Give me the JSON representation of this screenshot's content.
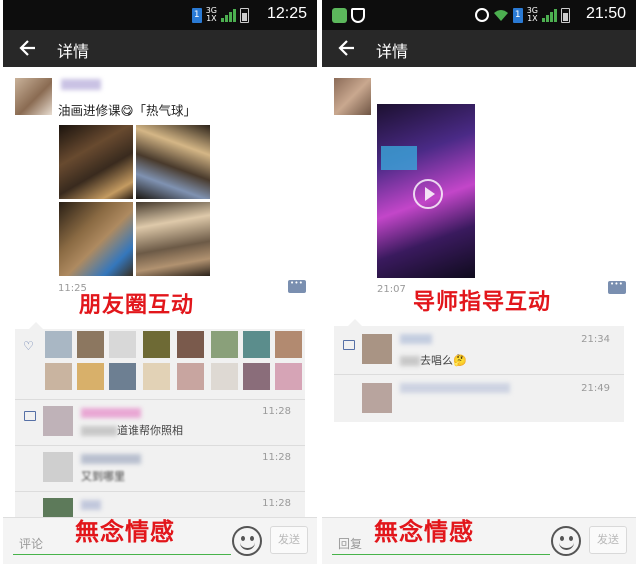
{
  "left": {
    "status_time": "12:25",
    "network": "3G",
    "network2": "1X",
    "title": "详情",
    "post_text": "油画进修课😋「热气球」",
    "post_time": "11:25",
    "caption": "朋友圈互动",
    "comments": [
      {
        "text": "道谁帮你照相",
        "time": "11:28"
      },
      {
        "text": "又到哪里",
        "time": "11:28"
      },
      {
        "text": "",
        "time": "11:28"
      }
    ],
    "input_placeholder": "评论",
    "send_label": "发送",
    "watermark": "無念情感"
  },
  "right": {
    "status_time": "21:50",
    "network": "3G",
    "network2": "1X",
    "title": "详情",
    "post_time": "21:07",
    "caption": "导师指导互动",
    "comments": [
      {
        "text": "去唱么🤔",
        "time": "21:34"
      },
      {
        "text": "",
        "time": "21:49"
      }
    ],
    "input_placeholder": "回复",
    "send_label": "发送",
    "watermark": "無念情感"
  },
  "colors": {
    "accent_green": "#47b34a",
    "caption_red": "#e2161b",
    "link_blue": "#5670a6",
    "actionbar": "#282828"
  },
  "icons": [
    "back-arrow-icon",
    "heart-icon",
    "comment-icon",
    "emoji-icon",
    "play-icon",
    "sim-icon",
    "battery-icon",
    "wifi-icon",
    "alarm-icon",
    "shield-icon"
  ]
}
